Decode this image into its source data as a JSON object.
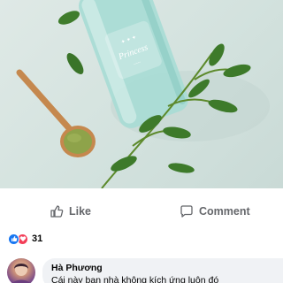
{
  "post": {
    "image_alt": "Product photo",
    "bottle_label": "Princess"
  },
  "actions": {
    "like_label": "Like",
    "comment_label": "Comment"
  },
  "reactions": {
    "count": "31",
    "types": [
      "like-icon",
      "love-icon"
    ]
  },
  "comment": {
    "author": "Hà Phương",
    "text": "Cái này bạn nhà không kích ứng luôn đó"
  },
  "colors": {
    "facebook_blue": "#1877f2",
    "love_red": "#f33e58",
    "muted_text": "#65676b",
    "comment_bubble": "#f0f2f5"
  }
}
